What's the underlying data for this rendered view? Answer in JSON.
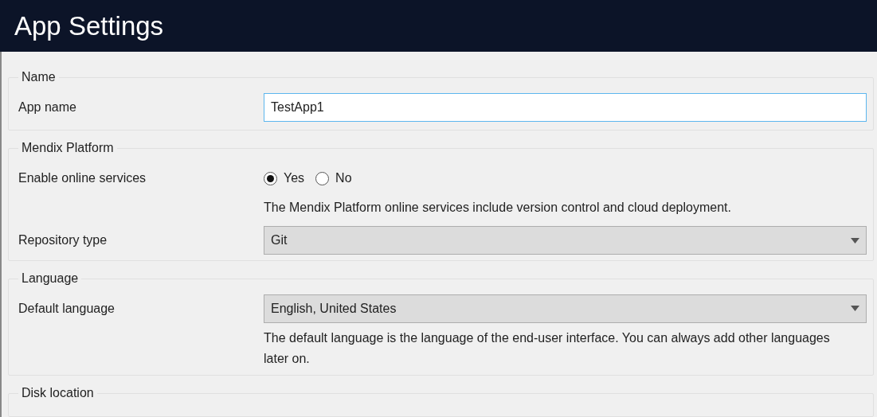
{
  "window": {
    "title": "App Settings"
  },
  "sections": [
    {
      "legend": "Name",
      "rows": [
        {
          "kind": "text",
          "label": "App name",
          "value": "TestApp1",
          "focused": true
        }
      ]
    },
    {
      "legend": "Mendix Platform",
      "rows": [
        {
          "kind": "radio",
          "label": "Enable online services",
          "options": [
            {
              "label": "Yes",
              "selected": true
            },
            {
              "label": "No",
              "selected": false
            }
          ],
          "description": "The Mendix Platform online services include version control and cloud deployment."
        },
        {
          "kind": "select",
          "label": "Repository type",
          "value": "Git"
        }
      ]
    },
    {
      "legend": "Language",
      "rows": [
        {
          "kind": "select",
          "label": "Default language",
          "value": "English, United States",
          "description": "The default language is the language of the end-user interface. You can always add other languages later on."
        }
      ]
    },
    {
      "legend": "Disk location"
    }
  ]
}
